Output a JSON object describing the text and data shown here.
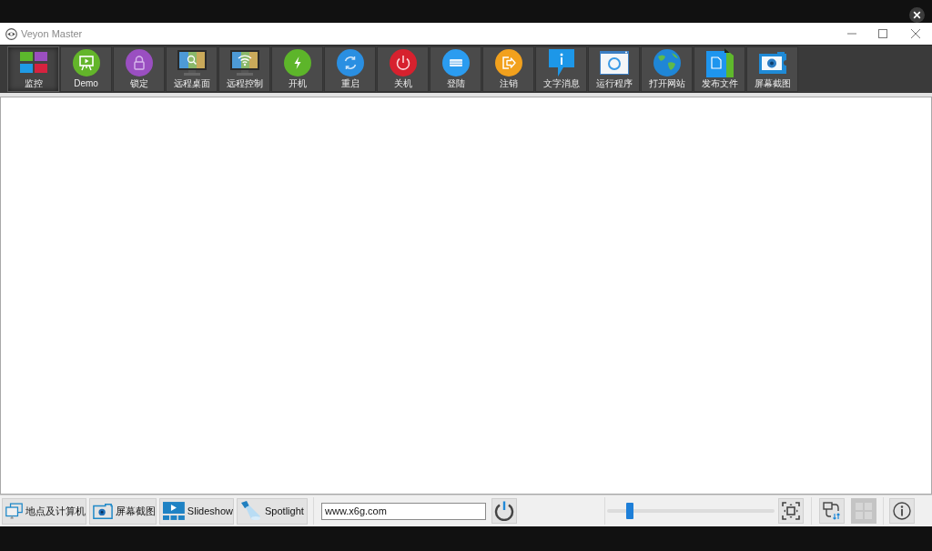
{
  "window": {
    "title": "Veyon Master"
  },
  "toolbar": [
    {
      "kind": "monitoring",
      "label": "监控",
      "selected": true
    },
    {
      "kind": "demo",
      "label": "Demo",
      "selected": false
    },
    {
      "kind": "lock",
      "label": "锁定",
      "selected": false
    },
    {
      "kind": "remote-view",
      "label": "远程桌面",
      "selected": false
    },
    {
      "kind": "remote-control",
      "label": "远程控制",
      "selected": false
    },
    {
      "kind": "power-on",
      "label": "开机",
      "selected": false
    },
    {
      "kind": "reboot",
      "label": "重启",
      "selected": false
    },
    {
      "kind": "power-down",
      "label": "关机",
      "selected": false
    },
    {
      "kind": "logon",
      "label": "登陆",
      "selected": false
    },
    {
      "kind": "logoff",
      "label": "注销",
      "selected": false
    },
    {
      "kind": "message",
      "label": "文字消息",
      "selected": false
    },
    {
      "kind": "run",
      "label": "运行程序",
      "selected": false
    },
    {
      "kind": "website",
      "label": "打开网站",
      "selected": false
    },
    {
      "kind": "file",
      "label": "发布文件",
      "selected": false
    },
    {
      "kind": "screenshot",
      "label": "屏幕截图",
      "selected": false
    }
  ],
  "bottom_bar": {
    "panel_buttons": [
      {
        "kind": "locations",
        "label": "地点及计算机"
      },
      {
        "kind": "screenshots",
        "label": "屏幕截图"
      },
      {
        "kind": "slideshow",
        "label": "Slideshow"
      },
      {
        "kind": "spotlight",
        "label": "Spotlight"
      }
    ],
    "filter_field": {
      "value": "www.x6g.com"
    },
    "zoom_slider": {
      "level": 0.12
    },
    "tool_buttons": [
      {
        "kind": "fit",
        "disabled": false
      },
      {
        "kind": "arrange",
        "disabled": false
      },
      {
        "kind": "grid",
        "disabled": true
      },
      {
        "kind": "info",
        "disabled": false
      }
    ]
  }
}
